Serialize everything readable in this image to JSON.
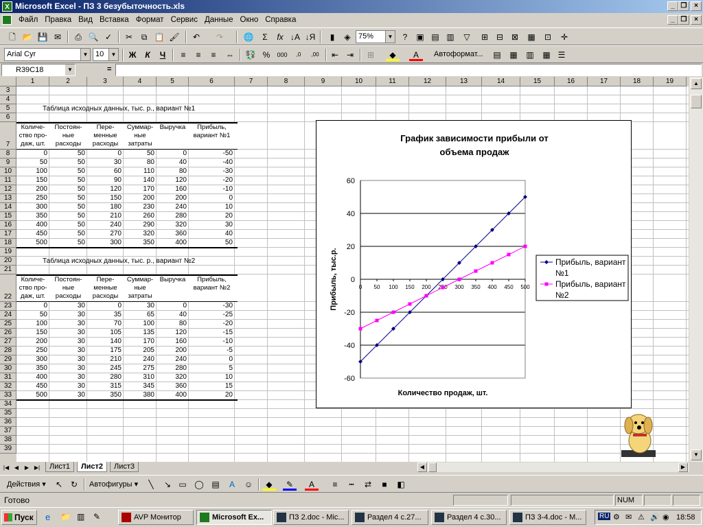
{
  "window": {
    "title": "Microsoft Excel - ПЗ 3 безубыточность.xls"
  },
  "menu": [
    "Файл",
    "Правка",
    "Вид",
    "Вставка",
    "Формат",
    "Сервис",
    "Данные",
    "Окно",
    "Справка"
  ],
  "toolbar": {
    "zoom": "75%",
    "font": "Arial Cyr",
    "size": "10",
    "bold": "Ж",
    "italic": "К",
    "underline": "Ч",
    "autoformat": "Автоформат..."
  },
  "formula": {
    "namebox": "R39C18",
    "eq": "="
  },
  "columns": [
    "1",
    "2",
    "3",
    "4",
    "5",
    "6",
    "7",
    "8",
    "9",
    "10",
    "11",
    "12",
    "13",
    "14",
    "15",
    "16",
    "17",
    "18",
    "19"
  ],
  "rows": [
    "3",
    "4",
    "5",
    "6",
    "7",
    "8",
    "9",
    "10",
    "11",
    "12",
    "13",
    "14",
    "15",
    "16",
    "17",
    "18",
    "19",
    "20",
    "21",
    "22",
    "23",
    "24",
    "25",
    "26",
    "27",
    "28",
    "29",
    "30",
    "31",
    "32",
    "33",
    "34",
    "35",
    "36",
    "37",
    "38",
    "39"
  ],
  "table1": {
    "title": "Таблица исходных данных, тыс. р., вариант №1",
    "headers": [
      "Количе-ство про-даж, шт.",
      "Постоян-ные расходы",
      "Пере-менные расходы",
      "Суммар-ные затраты",
      "Выручка",
      "Прибыль, вариант №1"
    ],
    "rows": [
      [
        "0",
        "50",
        "0",
        "50",
        "0",
        "-50"
      ],
      [
        "50",
        "50",
        "30",
        "80",
        "40",
        "-40"
      ],
      [
        "100",
        "50",
        "60",
        "110",
        "80",
        "-30"
      ],
      [
        "150",
        "50",
        "90",
        "140",
        "120",
        "-20"
      ],
      [
        "200",
        "50",
        "120",
        "170",
        "160",
        "-10"
      ],
      [
        "250",
        "50",
        "150",
        "200",
        "200",
        "0"
      ],
      [
        "300",
        "50",
        "180",
        "230",
        "240",
        "10"
      ],
      [
        "350",
        "50",
        "210",
        "260",
        "280",
        "20"
      ],
      [
        "400",
        "50",
        "240",
        "290",
        "320",
        "30"
      ],
      [
        "450",
        "50",
        "270",
        "320",
        "360",
        "40"
      ],
      [
        "500",
        "50",
        "300",
        "350",
        "400",
        "50"
      ]
    ]
  },
  "table2": {
    "title": "Таблица исходных данных, тыс. р., вариант №2",
    "headers": [
      "Количе-ство про-даж, шт.",
      "Постоян-ные расходы",
      "Пере-менные расходы",
      "Суммар-ные затраты",
      "Выручка",
      "Прибыль, вариант №2"
    ],
    "rows": [
      [
        "0",
        "30",
        "0",
        "30",
        "0",
        "-30"
      ],
      [
        "50",
        "30",
        "35",
        "65",
        "40",
        "-25"
      ],
      [
        "100",
        "30",
        "70",
        "100",
        "80",
        "-20"
      ],
      [
        "150",
        "30",
        "105",
        "135",
        "120",
        "-15"
      ],
      [
        "200",
        "30",
        "140",
        "170",
        "160",
        "-10"
      ],
      [
        "250",
        "30",
        "175",
        "205",
        "200",
        "-5"
      ],
      [
        "300",
        "30",
        "210",
        "240",
        "240",
        "0"
      ],
      [
        "350",
        "30",
        "245",
        "275",
        "280",
        "5"
      ],
      [
        "400",
        "30",
        "280",
        "310",
        "320",
        "10"
      ],
      [
        "450",
        "30",
        "315",
        "345",
        "360",
        "15"
      ],
      [
        "500",
        "30",
        "350",
        "380",
        "400",
        "20"
      ]
    ]
  },
  "chart_data": {
    "type": "line",
    "title": "График зависимости прибыли от объема продаж",
    "xlabel": "Количество продаж, шт.",
    "ylabel": "Прибыль, тыс.р.",
    "categories": [
      "0",
      "50",
      "100",
      "150",
      "200",
      "250",
      "300",
      "350",
      "400",
      "450",
      "500"
    ],
    "ylim": [
      -60,
      60
    ],
    "yticks": [
      "60",
      "40",
      "20",
      "0",
      "-20",
      "-40",
      "-60"
    ],
    "grid": true,
    "legend": "right",
    "series": [
      {
        "name": "Прибыль, вариант №1",
        "values": [
          -50,
          -40,
          -30,
          -20,
          -10,
          0,
          10,
          20,
          30,
          40,
          50
        ],
        "color": "#000080"
      },
      {
        "name": "Прибыль, вариант №2",
        "values": [
          -30,
          -25,
          -20,
          -15,
          -10,
          -5,
          0,
          5,
          10,
          15,
          20
        ],
        "color": "#ff00ff"
      }
    ]
  },
  "sheets": [
    "Лист1",
    "Лист2",
    "Лист3"
  ],
  "drawing": {
    "actions": "Действия",
    "autoshapes": "Автофигуры"
  },
  "status": {
    "text": "Готово",
    "num": "NUM"
  },
  "taskbar": {
    "start": "Пуск",
    "tasks": [
      "AVP Монитор",
      "Microsoft Ex...",
      "ПЗ 2.doc - Mic...",
      "Раздел 4 с.27...",
      "Раздел 4 с.30...",
      "ПЗ 3-4.doc - М..."
    ],
    "lang": "RU",
    "time": "18:58"
  }
}
